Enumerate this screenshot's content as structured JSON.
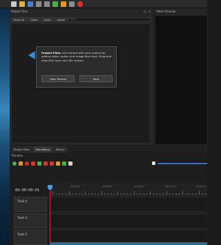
{
  "panels": {
    "project_files_title": "Project Files",
    "video_preview_title": "Video Preview",
    "close_glyph": "✕",
    "float_glyph": "◫"
  },
  "project_files": {
    "tabs": [
      "Show All",
      "Video",
      "Audio",
      "Image"
    ],
    "filter_placeholder": "Filter"
  },
  "tutorial": {
    "heading": "Project Files:",
    "body": "Get started with your project by adding video, audio, and image files here. Drag and drop files from your file system.",
    "hide_label": "Hide Tutorial",
    "next_label": "Next"
  },
  "bottom_tabs": [
    "Project Files",
    "Transitions",
    "Effects"
  ],
  "timeline": {
    "title": "Timeline",
    "timecode": "00:00:00:01",
    "ruler_labels": [
      "00:00:15",
      "00:00:30",
      "00:00:45",
      "00:01:00",
      "00:01:15"
    ],
    "tracks": [
      "Track 4",
      "Track 3",
      "Track 2"
    ]
  },
  "colors": {
    "accent_blue": "#3b8fd9",
    "playhead_red": "#d0243a",
    "toolbar_red": "#d9342b",
    "toolbar_green": "#4cae4c",
    "toolbar_orange": "#e09a1e"
  }
}
